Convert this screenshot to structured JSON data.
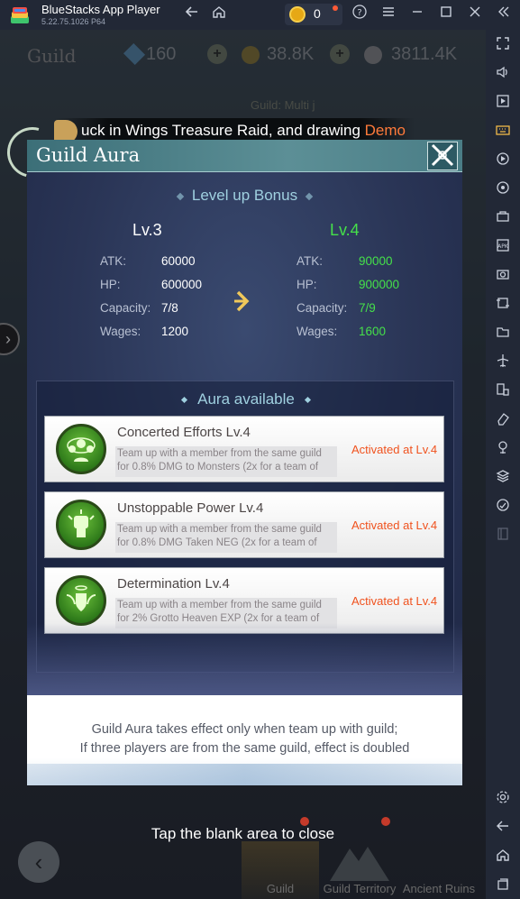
{
  "titlebar": {
    "app_name": "BlueStacks App Player",
    "app_version": "5.22.75.1026  P64",
    "coin_count": "0",
    "icons": [
      "back-arrow-icon",
      "home-icon",
      "help-icon",
      "menu-icon",
      "minimize-icon",
      "maximize-icon",
      "close-icon",
      "collapse-sidebar-icon"
    ]
  },
  "sidebar": {
    "icons": [
      "fullscreen-icon",
      "volume-icon",
      "media-icon",
      "keyboard-icon",
      "record-icon",
      "rotate-icon",
      "screenshot-icon",
      "apk-icon",
      "camera-icon",
      "resize-icon",
      "folder-icon",
      "airplane-icon",
      "multi-instance-icon",
      "erase-icon",
      "location-icon",
      "layers-icon",
      "eco-icon",
      "macro-icon",
      "settings-icon",
      "back-icon",
      "home-icon",
      "recents-icon"
    ]
  },
  "game": {
    "guild_tab": "Guild",
    "gems": "160",
    "gold": "38.8K",
    "silver": "3811.4K",
    "guild_name": "Guild:  Multi j",
    "marquee_text": "uck in Wings Treasure Raid, and drawing ",
    "marquee_highlight": "Demo"
  },
  "dialog": {
    "title": "Guild Aura",
    "level_heading": "Level up Bonus",
    "current": {
      "level": "Lv.3",
      "atk_label": "ATK:",
      "atk": "60000",
      "hp_label": "HP:",
      "hp": "600000",
      "capacity_label": "Capacity:",
      "capacity": "7/8",
      "wages_label": "Wages:",
      "wages": "1200"
    },
    "next": {
      "level": "Lv.4",
      "atk_label": "ATK:",
      "atk": "90000",
      "hp_label": "HP:",
      "hp": "900000",
      "capacity_label": "Capacity:",
      "capacity": "7/9",
      "wages_label": "Wages:",
      "wages": "1600"
    },
    "aura_heading": "Aura available",
    "auras": [
      {
        "name": "Concerted Efforts Lv.4",
        "desc_line1": "Team up with a member from the same guild",
        "desc_line2": "for 0.8% DMG to Monsters (2x for a team of",
        "status": "Activated at Lv.4",
        "icon": "team-icon"
      },
      {
        "name": "Unstoppable Power Lv.4",
        "desc_line1": "Team up with a member from the same guild",
        "desc_line2": "for 0.8% DMG Taken NEG (2x for a team of",
        "status": "Activated at Lv.4",
        "icon": "fist-icon"
      },
      {
        "name": "Determination Lv.4",
        "desc_line1": "Team up with a member from the same guild",
        "desc_line2": "for 2% Grotto Heaven EXP (2x for a team of",
        "status": "Activated at Lv.4",
        "icon": "angel-shield-icon"
      }
    ],
    "footer_line1": "Guild Aura takes effect only when team up with guild;",
    "footer_line2": "If three players are from the same guild, effect is doubled"
  },
  "tap_close": "Tap the blank area to close",
  "bottom_nav": {
    "items": [
      {
        "label": "Guild"
      },
      {
        "label": "Guild Territory"
      },
      {
        "label": "Ancient Ruins"
      }
    ]
  },
  "colors": {
    "stat_new": "#45e04a",
    "aura_status": "#f0521e",
    "heading": "#9fd0e0"
  }
}
